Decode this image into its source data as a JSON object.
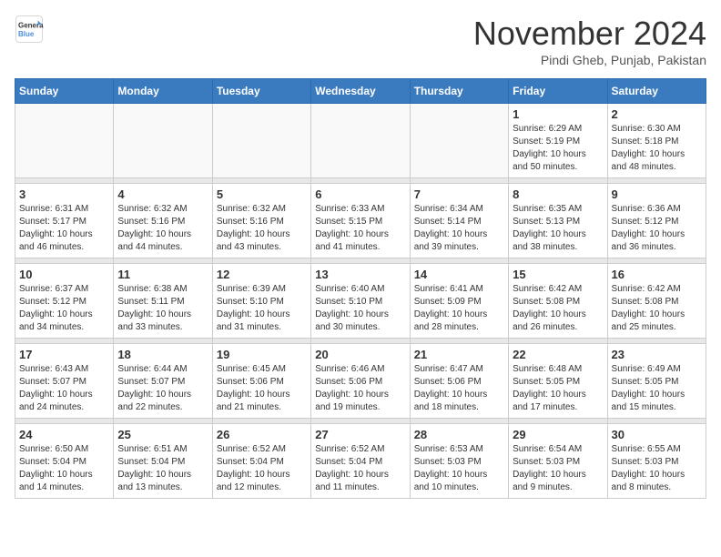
{
  "header": {
    "logo_line1": "General",
    "logo_line2": "Blue",
    "month": "November 2024",
    "location": "Pindi Gheb, Punjab, Pakistan"
  },
  "weekdays": [
    "Sunday",
    "Monday",
    "Tuesday",
    "Wednesday",
    "Thursday",
    "Friday",
    "Saturday"
  ],
  "weeks": [
    [
      {
        "day": "",
        "sunrise": "",
        "sunset": "",
        "daylight": ""
      },
      {
        "day": "",
        "sunrise": "",
        "sunset": "",
        "daylight": ""
      },
      {
        "day": "",
        "sunrise": "",
        "sunset": "",
        "daylight": ""
      },
      {
        "day": "",
        "sunrise": "",
        "sunset": "",
        "daylight": ""
      },
      {
        "day": "",
        "sunrise": "",
        "sunset": "",
        "daylight": ""
      },
      {
        "day": "1",
        "sunrise": "Sunrise: 6:29 AM",
        "sunset": "Sunset: 5:19 PM",
        "daylight": "Daylight: 10 hours and 50 minutes."
      },
      {
        "day": "2",
        "sunrise": "Sunrise: 6:30 AM",
        "sunset": "Sunset: 5:18 PM",
        "daylight": "Daylight: 10 hours and 48 minutes."
      }
    ],
    [
      {
        "day": "3",
        "sunrise": "Sunrise: 6:31 AM",
        "sunset": "Sunset: 5:17 PM",
        "daylight": "Daylight: 10 hours and 46 minutes."
      },
      {
        "day": "4",
        "sunrise": "Sunrise: 6:32 AM",
        "sunset": "Sunset: 5:16 PM",
        "daylight": "Daylight: 10 hours and 44 minutes."
      },
      {
        "day": "5",
        "sunrise": "Sunrise: 6:32 AM",
        "sunset": "Sunset: 5:16 PM",
        "daylight": "Daylight: 10 hours and 43 minutes."
      },
      {
        "day": "6",
        "sunrise": "Sunrise: 6:33 AM",
        "sunset": "Sunset: 5:15 PM",
        "daylight": "Daylight: 10 hours and 41 minutes."
      },
      {
        "day": "7",
        "sunrise": "Sunrise: 6:34 AM",
        "sunset": "Sunset: 5:14 PM",
        "daylight": "Daylight: 10 hours and 39 minutes."
      },
      {
        "day": "8",
        "sunrise": "Sunrise: 6:35 AM",
        "sunset": "Sunset: 5:13 PM",
        "daylight": "Daylight: 10 hours and 38 minutes."
      },
      {
        "day": "9",
        "sunrise": "Sunrise: 6:36 AM",
        "sunset": "Sunset: 5:12 PM",
        "daylight": "Daylight: 10 hours and 36 minutes."
      }
    ],
    [
      {
        "day": "10",
        "sunrise": "Sunrise: 6:37 AM",
        "sunset": "Sunset: 5:12 PM",
        "daylight": "Daylight: 10 hours and 34 minutes."
      },
      {
        "day": "11",
        "sunrise": "Sunrise: 6:38 AM",
        "sunset": "Sunset: 5:11 PM",
        "daylight": "Daylight: 10 hours and 33 minutes."
      },
      {
        "day": "12",
        "sunrise": "Sunrise: 6:39 AM",
        "sunset": "Sunset: 5:10 PM",
        "daylight": "Daylight: 10 hours and 31 minutes."
      },
      {
        "day": "13",
        "sunrise": "Sunrise: 6:40 AM",
        "sunset": "Sunset: 5:10 PM",
        "daylight": "Daylight: 10 hours and 30 minutes."
      },
      {
        "day": "14",
        "sunrise": "Sunrise: 6:41 AM",
        "sunset": "Sunset: 5:09 PM",
        "daylight": "Daylight: 10 hours and 28 minutes."
      },
      {
        "day": "15",
        "sunrise": "Sunrise: 6:42 AM",
        "sunset": "Sunset: 5:08 PM",
        "daylight": "Daylight: 10 hours and 26 minutes."
      },
      {
        "day": "16",
        "sunrise": "Sunrise: 6:42 AM",
        "sunset": "Sunset: 5:08 PM",
        "daylight": "Daylight: 10 hours and 25 minutes."
      }
    ],
    [
      {
        "day": "17",
        "sunrise": "Sunrise: 6:43 AM",
        "sunset": "Sunset: 5:07 PM",
        "daylight": "Daylight: 10 hours and 24 minutes."
      },
      {
        "day": "18",
        "sunrise": "Sunrise: 6:44 AM",
        "sunset": "Sunset: 5:07 PM",
        "daylight": "Daylight: 10 hours and 22 minutes."
      },
      {
        "day": "19",
        "sunrise": "Sunrise: 6:45 AM",
        "sunset": "Sunset: 5:06 PM",
        "daylight": "Daylight: 10 hours and 21 minutes."
      },
      {
        "day": "20",
        "sunrise": "Sunrise: 6:46 AM",
        "sunset": "Sunset: 5:06 PM",
        "daylight": "Daylight: 10 hours and 19 minutes."
      },
      {
        "day": "21",
        "sunrise": "Sunrise: 6:47 AM",
        "sunset": "Sunset: 5:06 PM",
        "daylight": "Daylight: 10 hours and 18 minutes."
      },
      {
        "day": "22",
        "sunrise": "Sunrise: 6:48 AM",
        "sunset": "Sunset: 5:05 PM",
        "daylight": "Daylight: 10 hours and 17 minutes."
      },
      {
        "day": "23",
        "sunrise": "Sunrise: 6:49 AM",
        "sunset": "Sunset: 5:05 PM",
        "daylight": "Daylight: 10 hours and 15 minutes."
      }
    ],
    [
      {
        "day": "24",
        "sunrise": "Sunrise: 6:50 AM",
        "sunset": "Sunset: 5:04 PM",
        "daylight": "Daylight: 10 hours and 14 minutes."
      },
      {
        "day": "25",
        "sunrise": "Sunrise: 6:51 AM",
        "sunset": "Sunset: 5:04 PM",
        "daylight": "Daylight: 10 hours and 13 minutes."
      },
      {
        "day": "26",
        "sunrise": "Sunrise: 6:52 AM",
        "sunset": "Sunset: 5:04 PM",
        "daylight": "Daylight: 10 hours and 12 minutes."
      },
      {
        "day": "27",
        "sunrise": "Sunrise: 6:52 AM",
        "sunset": "Sunset: 5:04 PM",
        "daylight": "Daylight: 10 hours and 11 minutes."
      },
      {
        "day": "28",
        "sunrise": "Sunrise: 6:53 AM",
        "sunset": "Sunset: 5:03 PM",
        "daylight": "Daylight: 10 hours and 10 minutes."
      },
      {
        "day": "29",
        "sunrise": "Sunrise: 6:54 AM",
        "sunset": "Sunset: 5:03 PM",
        "daylight": "Daylight: 10 hours and 9 minutes."
      },
      {
        "day": "30",
        "sunrise": "Sunrise: 6:55 AM",
        "sunset": "Sunset: 5:03 PM",
        "daylight": "Daylight: 10 hours and 8 minutes."
      }
    ]
  ]
}
